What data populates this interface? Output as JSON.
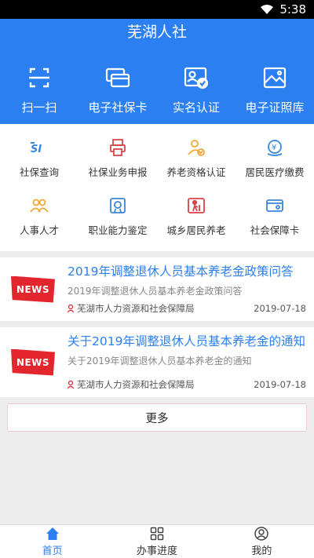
{
  "status": {
    "time": "5:38"
  },
  "app": {
    "title": "芜湖人社"
  },
  "quick_actions": [
    {
      "label": "扫一扫",
      "icon": "scan-icon"
    },
    {
      "label": "电子社保卡",
      "icon": "cards-icon"
    },
    {
      "label": "实名认证",
      "icon": "id-verify-icon"
    },
    {
      "label": "电子证照库",
      "icon": "gallery-icon"
    }
  ],
  "services": [
    {
      "label": "社保查询",
      "icon": "si-search-icon"
    },
    {
      "label": "社保业务申报",
      "icon": "printer-icon"
    },
    {
      "label": "养老资格认证",
      "icon": "person-check-icon"
    },
    {
      "label": "居民医疗缴费",
      "icon": "payment-icon"
    },
    {
      "label": "人事人才",
      "icon": "people-icon"
    },
    {
      "label": "职业能力鉴定",
      "icon": "certificate-icon"
    },
    {
      "label": "城乡居民养老",
      "icon": "elder-icon"
    },
    {
      "label": "社会保障卡",
      "icon": "card-icon"
    }
  ],
  "news": [
    {
      "badge": "NEWS",
      "title": "2019年调整退休人员基本养老金政策问答",
      "desc": "2019年调整退休人员基本养老金政策问答",
      "source": "芜湖市人力资源和社会保障局",
      "date": "2019-07-18"
    },
    {
      "badge": "NEWS",
      "title": "关于2019年调整退休人员基本养老金的通知",
      "desc": "关于2019年调整退休人员基本养老金的通知",
      "source": "芜湖市人力资源和社会保障局",
      "date": "2019-07-18"
    }
  ],
  "more_label": "更多",
  "tabs": [
    {
      "label": "首页",
      "icon": "home-icon",
      "active": true
    },
    {
      "label": "办事进度",
      "icon": "grid-icon",
      "active": false
    },
    {
      "label": "我的",
      "icon": "user-icon",
      "active": false
    }
  ],
  "colors": {
    "brand": "#2b7ff0",
    "news_badge": "#e3262e",
    "icon_blue": "#3a86d8",
    "icon_orange": "#f0a838",
    "icon_red": "#d9434a"
  }
}
